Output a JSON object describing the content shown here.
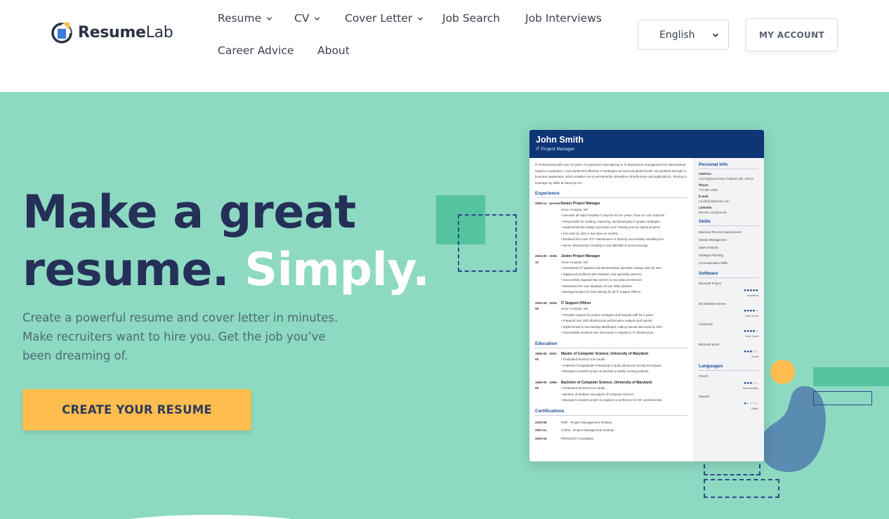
{
  "header": {
    "logo": {
      "strong": "Resume",
      "light": "Lab"
    },
    "nav": [
      {
        "label": "Resume",
        "dropdown": true
      },
      {
        "label": "CV",
        "dropdown": true
      },
      {
        "label": "Cover Letter",
        "dropdown": true
      },
      {
        "label": "Job Search",
        "dropdown": false
      },
      {
        "label": "Job Interviews",
        "dropdown": false
      },
      {
        "label": "Career Advice",
        "dropdown": false
      },
      {
        "label": "About",
        "dropdown": false
      }
    ],
    "language": "English",
    "account_label": "MY ACCOUNT"
  },
  "hero": {
    "headline_line1": "Make a great",
    "headline_line2_dark": "resume.",
    "headline_line2_accent": "Simply.",
    "subtext": "Create a powerful resume and cover letter in minutes. Make recruiters want to hire you. Get the job you’ve been dreaming of.",
    "cta_label": "CREATE YOUR RESUME"
  },
  "resume_preview": {
    "name": "John Smith",
    "role": "IT Project Manager",
    "summary": "IT Professional with over 10 years of experience specializing in IT department management for international logistics companies. I can implement effective IT strategies at local and global levels. My greatest strength is business awareness, which enables me to permanently streamline infrastructure and applications. Striving to leverage my skills at SanCorp Inc.",
    "experience_title": "Experience",
    "jobs": [
      {
        "dates": "2006-12 - present",
        "title": "Senior Project Manager",
        "company": "Seton Hospital, ME",
        "bullets": [
          "Oversaw all major hospital IT projects for 10+ years, focus on cost reduction.",
          "Responsible for creating, improving, and developing IT project strategies.",
          "Implemented the highly successful Lean Training and Six Sigma projects.",
          "Cut costs by 32% in less than six months.",
          "Reduced the costs of IT maintenance in 2015 by successfully rebuilding the",
          "server infrastructure resulting in over $56'000 of annual savings."
        ]
      },
      {
        "dates": "2004-09 - 2006-12",
        "title": "Junior Project Manager",
        "company": "Seton Hospital, ME",
        "bullets": [
          "Streamlined IT logistics and administration operation cutting costs by 25%",
          "Diagnosed problems with hardware and operating systems.",
          "Successfully migrated two servers to new data architecture.",
          "Maintained the user database of over 3000 patients.",
          "Managed project for lean training for all IT Support Offices."
        ]
      },
      {
        "dates": "2002-08 - 2004-09",
        "title": "IT Support Officer",
        "company": "Seton Hospital, ME",
        "bullets": [
          "Provided support for project managers and hospital staff for 2 years.",
          "Prepared over 100 infrastructure performance analysis and reports.",
          "Implemented a new tracking dashboard, cutting manual data input by 30%.",
          "Successfully resolved over 200 issues in regards to IT infrastructure."
        ]
      }
    ],
    "education_title": "Education",
    "education": [
      {
        "dates": "1999-09 - 2001-05",
        "title": "Master of Computer Science, University of Maryland",
        "bullets": [
          "Graduated Summa Cum Laude.",
          "Andersen Postgraduate Fellowship to study advanced nursing techniques.",
          "Managed a student project to develop a weekly nursing podcast."
        ]
      },
      {
        "dates": "1996-09 - 1999-06",
        "title": "Bachelor of Computer Science, University of Maryland",
        "bullets": [
          "Graduated Summa Cum Laude.",
          "Member of Student Association of Computer Science.",
          "Managed a student project to organize a conference for 50+ professionals."
        ]
      }
    ],
    "certifications_title": "Certifications",
    "certifications": [
      {
        "date": "2010-05",
        "name": "PMP - Project Management Institute"
      },
      {
        "date": "2007-11",
        "name": "CAPM - Project Management Institute"
      },
      {
        "date": "2003-04",
        "name": "PRINCE2® Foundation"
      }
    ],
    "personal_title": "Personal Info",
    "personal": [
      {
        "label": "Address",
        "value": "134 Rightward Way Portland, ME, 04019"
      },
      {
        "label": "Phone",
        "value": "774-987-4009"
      },
      {
        "label": "E-mail",
        "value": "j.smith@uptowork.com"
      },
      {
        "label": "LinkedIn",
        "value": "linkedin.com/johnutw"
      }
    ],
    "skills_title": "Skills",
    "skills": [
      "Business Process Improvement",
      "Vendor Management",
      "Sales Analysis",
      "Strategic Planning",
      "Communication Skills"
    ],
    "software_title": "Software",
    "software": [
      {
        "name": "Microsoft Project",
        "level": "Excellent",
        "dots": 5
      },
      {
        "name": "MS Windows Server",
        "level": "Very Good",
        "dots": 4
      },
      {
        "name": "Linux/Unix",
        "level": "Very Good",
        "dots": 4
      },
      {
        "name": "Microsoft Excel",
        "level": "Good",
        "dots": 3
      }
    ],
    "languages_title": "Languages",
    "languages": [
      {
        "name": "French",
        "level": "Intermediate",
        "dots": 3
      },
      {
        "name": "Spanish",
        "level": "Basic",
        "dots": 1
      }
    ]
  },
  "colors": {
    "hero_bg": "#8dd9c2",
    "navy": "#243057",
    "cta": "#ffbd4f",
    "resume_header": "#0e3575"
  }
}
